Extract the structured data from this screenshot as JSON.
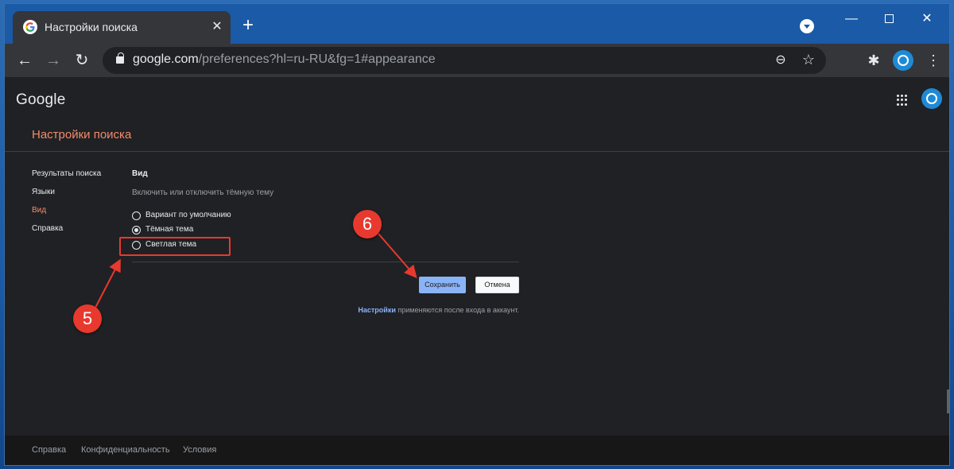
{
  "browser": {
    "tab_title": "Настройки поиска",
    "tab_close": "✕",
    "new_tab": "+",
    "url_host": "google.com",
    "url_path": "/preferences?hl=ru-RU&fg=1#appearance"
  },
  "page": {
    "logo": "Google",
    "title": "Настройки поиска",
    "sidenav": [
      {
        "label": "Результаты поиска",
        "active": false
      },
      {
        "label": "Языки",
        "active": false
      },
      {
        "label": "Вид",
        "active": true
      },
      {
        "label": "Справка",
        "active": false
      }
    ],
    "section": {
      "title": "Вид",
      "description": "Включить или отключить тёмную тему",
      "options": [
        {
          "label": "Вариант по умолчанию",
          "checked": false
        },
        {
          "label": "Тёмная тема",
          "checked": true
        },
        {
          "label": "Светлая тема",
          "checked": false
        }
      ]
    },
    "save_button": "Сохранить",
    "cancel_button": "Отмена",
    "note_link": "Настройки",
    "note_text": " применяются после входа в аккаунт."
  },
  "annotations": {
    "badge_5": "5",
    "badge_6": "6"
  },
  "footer": {
    "links": [
      "Справка",
      "Конфиденциальность",
      "Условия"
    ]
  },
  "colors": {
    "accent_title": "#f28b6c",
    "link": "#8ab4f8",
    "annotation": "#e8392f",
    "page_bg": "#202124"
  }
}
